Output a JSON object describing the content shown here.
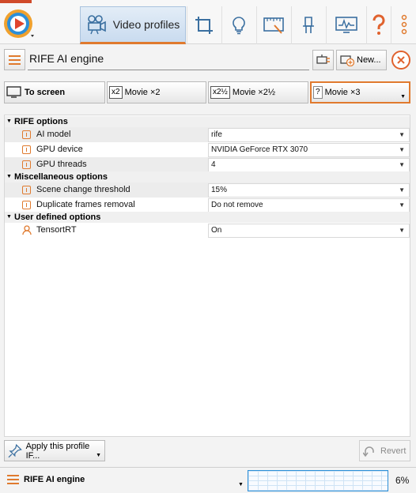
{
  "header": {
    "active_tab_label": "Video profiles"
  },
  "profile": {
    "name": "RIFE AI engine",
    "new_button": "New..."
  },
  "presets": [
    {
      "icon_text": "",
      "label": "To screen"
    },
    {
      "icon_text": "x2",
      "label": "Movie ×2"
    },
    {
      "icon_text": "x2½",
      "label": "Movie ×2½"
    },
    {
      "icon_text": "?",
      "label": "Movie ×3"
    }
  ],
  "sections": [
    {
      "title": "RIFE options",
      "rows": [
        {
          "label": "AI model",
          "value": "rife"
        },
        {
          "label": "GPU device",
          "value": "NVIDIA GeForce RTX 3070"
        },
        {
          "label": "GPU threads",
          "value": "4"
        }
      ]
    },
    {
      "title": "Miscellaneous options",
      "rows": [
        {
          "label": "Scene change threshold",
          "value": "15%"
        },
        {
          "label": "Duplicate frames removal",
          "value": "Do not remove"
        }
      ]
    },
    {
      "title": "User defined options",
      "rows": [
        {
          "label": "TensortRT",
          "value": "On"
        }
      ]
    }
  ],
  "bottom": {
    "apply_label": "Apply this profile IF...",
    "revert_label": "Revert"
  },
  "status": {
    "profile_name": "RIFE AI engine",
    "load_percent": "6%"
  },
  "colors": {
    "accent": "#e07a2e",
    "active_tab": "#c9dbef",
    "graph_border": "#2c8fd8"
  },
  "icons": {
    "tabs": [
      "app-logo-icon",
      "video-camera-icon",
      "crop-icon",
      "lightbulb-icon",
      "ruler-icon",
      "lamp-icon",
      "monitor-graph-icon",
      "help-icon",
      "more-icon"
    ]
  }
}
